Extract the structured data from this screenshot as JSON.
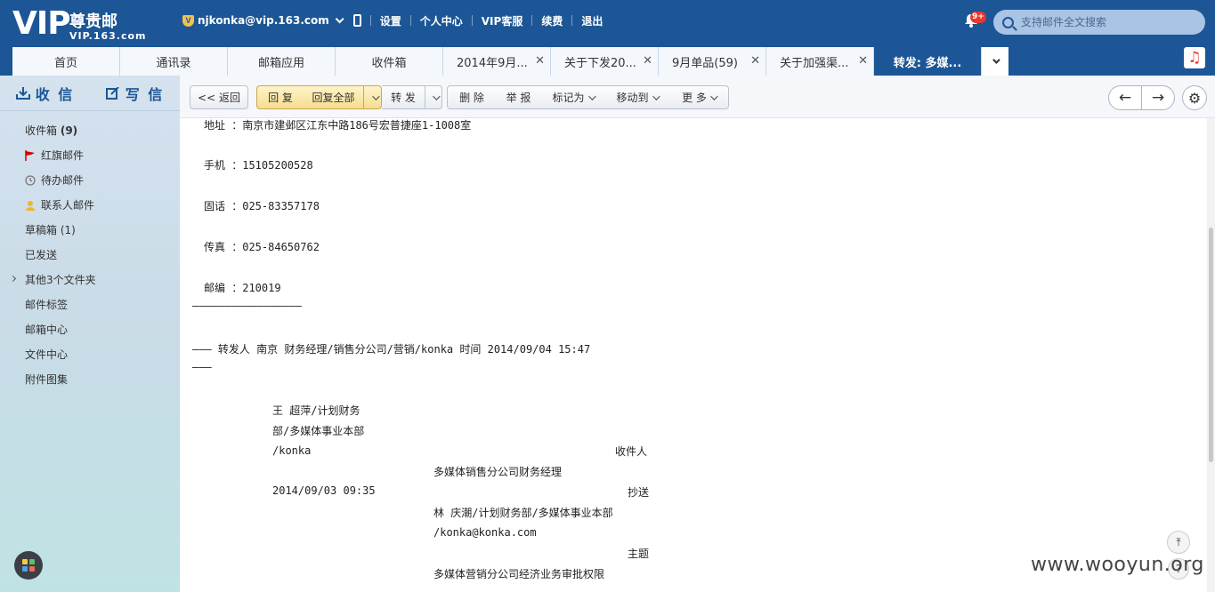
{
  "header": {
    "logo": {
      "brand": "VIP",
      "name": "尊贵邮",
      "domain": "VIP.163.com"
    },
    "account": "njkonka@vip.163.com",
    "nav": [
      "设置",
      "个人中心",
      "VIP客服",
      "续费",
      "退出"
    ],
    "notification_count": "9+",
    "search_placeholder": "支持邮件全文搜索"
  },
  "tabs": [
    {
      "label": "首页",
      "closable": false,
      "active": false
    },
    {
      "label": "通讯录",
      "closable": false,
      "active": false
    },
    {
      "label": "邮箱应用",
      "closable": false,
      "active": false
    },
    {
      "label": "收件箱",
      "closable": false,
      "active": false
    },
    {
      "label": "2014年9月...",
      "closable": true,
      "active": false
    },
    {
      "label": "关于下发20...",
      "closable": true,
      "active": false
    },
    {
      "label": "9月单品(59)",
      "closable": true,
      "active": false
    },
    {
      "label": "关于加强渠...",
      "closable": true,
      "active": false
    },
    {
      "label": "转发: 多媒...",
      "closable": false,
      "active": true
    }
  ],
  "sidebar": {
    "receive": "收 信",
    "compose": "写 信",
    "folders": [
      {
        "label": "收件箱",
        "count": "(9)",
        "icon": ""
      },
      {
        "label": "红旗邮件",
        "count": "",
        "icon": "flag-icon"
      },
      {
        "label": "待办邮件",
        "count": "",
        "icon": "clock-icon"
      },
      {
        "label": "联系人邮件",
        "count": "",
        "icon": "contact-icon"
      },
      {
        "label": "草稿箱 (1)",
        "count": "",
        "icon": ""
      },
      {
        "label": "已发送",
        "count": "",
        "icon": ""
      },
      {
        "label": "其他3个文件夹",
        "count": "",
        "icon": "",
        "expandable": true
      },
      {
        "label": "邮件标签",
        "count": "",
        "icon": ""
      },
      {
        "label": "邮箱中心",
        "count": "",
        "icon": ""
      },
      {
        "label": "文件中心",
        "count": "",
        "icon": ""
      },
      {
        "label": "附件图集",
        "count": "",
        "icon": ""
      }
    ]
  },
  "toolbar": {
    "back": "<< 返回",
    "reply": "回 复",
    "reply_all": "回复全部",
    "forward": "转 发",
    "delete": "删 除",
    "report": "举 报",
    "mark_as": "标记为",
    "move_to": "移动到",
    "more": "更 多"
  },
  "content": {
    "address": "地址 ：南京市建邺区江东中路186号宏普捷座1-1008室",
    "mobile": "手机 ：15105200528",
    "phone": "固话 ：025-83357178",
    "fax": "传真 ：025-84650762",
    "postcode": "邮编 ：210019",
    "divider": "—————————————————",
    "forward_header": "——— 转发人 南京 财务经理/销售分公司/营销/konka 时间 2014/09/04 15:47",
    "forward_tail": "———",
    "sender_line1": "王 超萍/计划财务",
    "sender_line2": "部/多媒体事业本部",
    "sender_line3": "/konka",
    "to_label": "收件人",
    "to_value": "多媒体销售分公司财务经理",
    "date": "2014/09/03 09:35",
    "cc_label": "抄送",
    "cc_value": "林 庆潮/计划财务部/多媒体事业本部",
    "cc_email": "/konka@konka.com",
    "subject_label": "主题",
    "subject_value": "多媒体营销分公司经济业务审批权限"
  },
  "watermark": "www.wooyun.org",
  "colors": {
    "header": "#1c5696",
    "active_tab": "#1c5696",
    "highlight_button": "#f5dd90"
  }
}
